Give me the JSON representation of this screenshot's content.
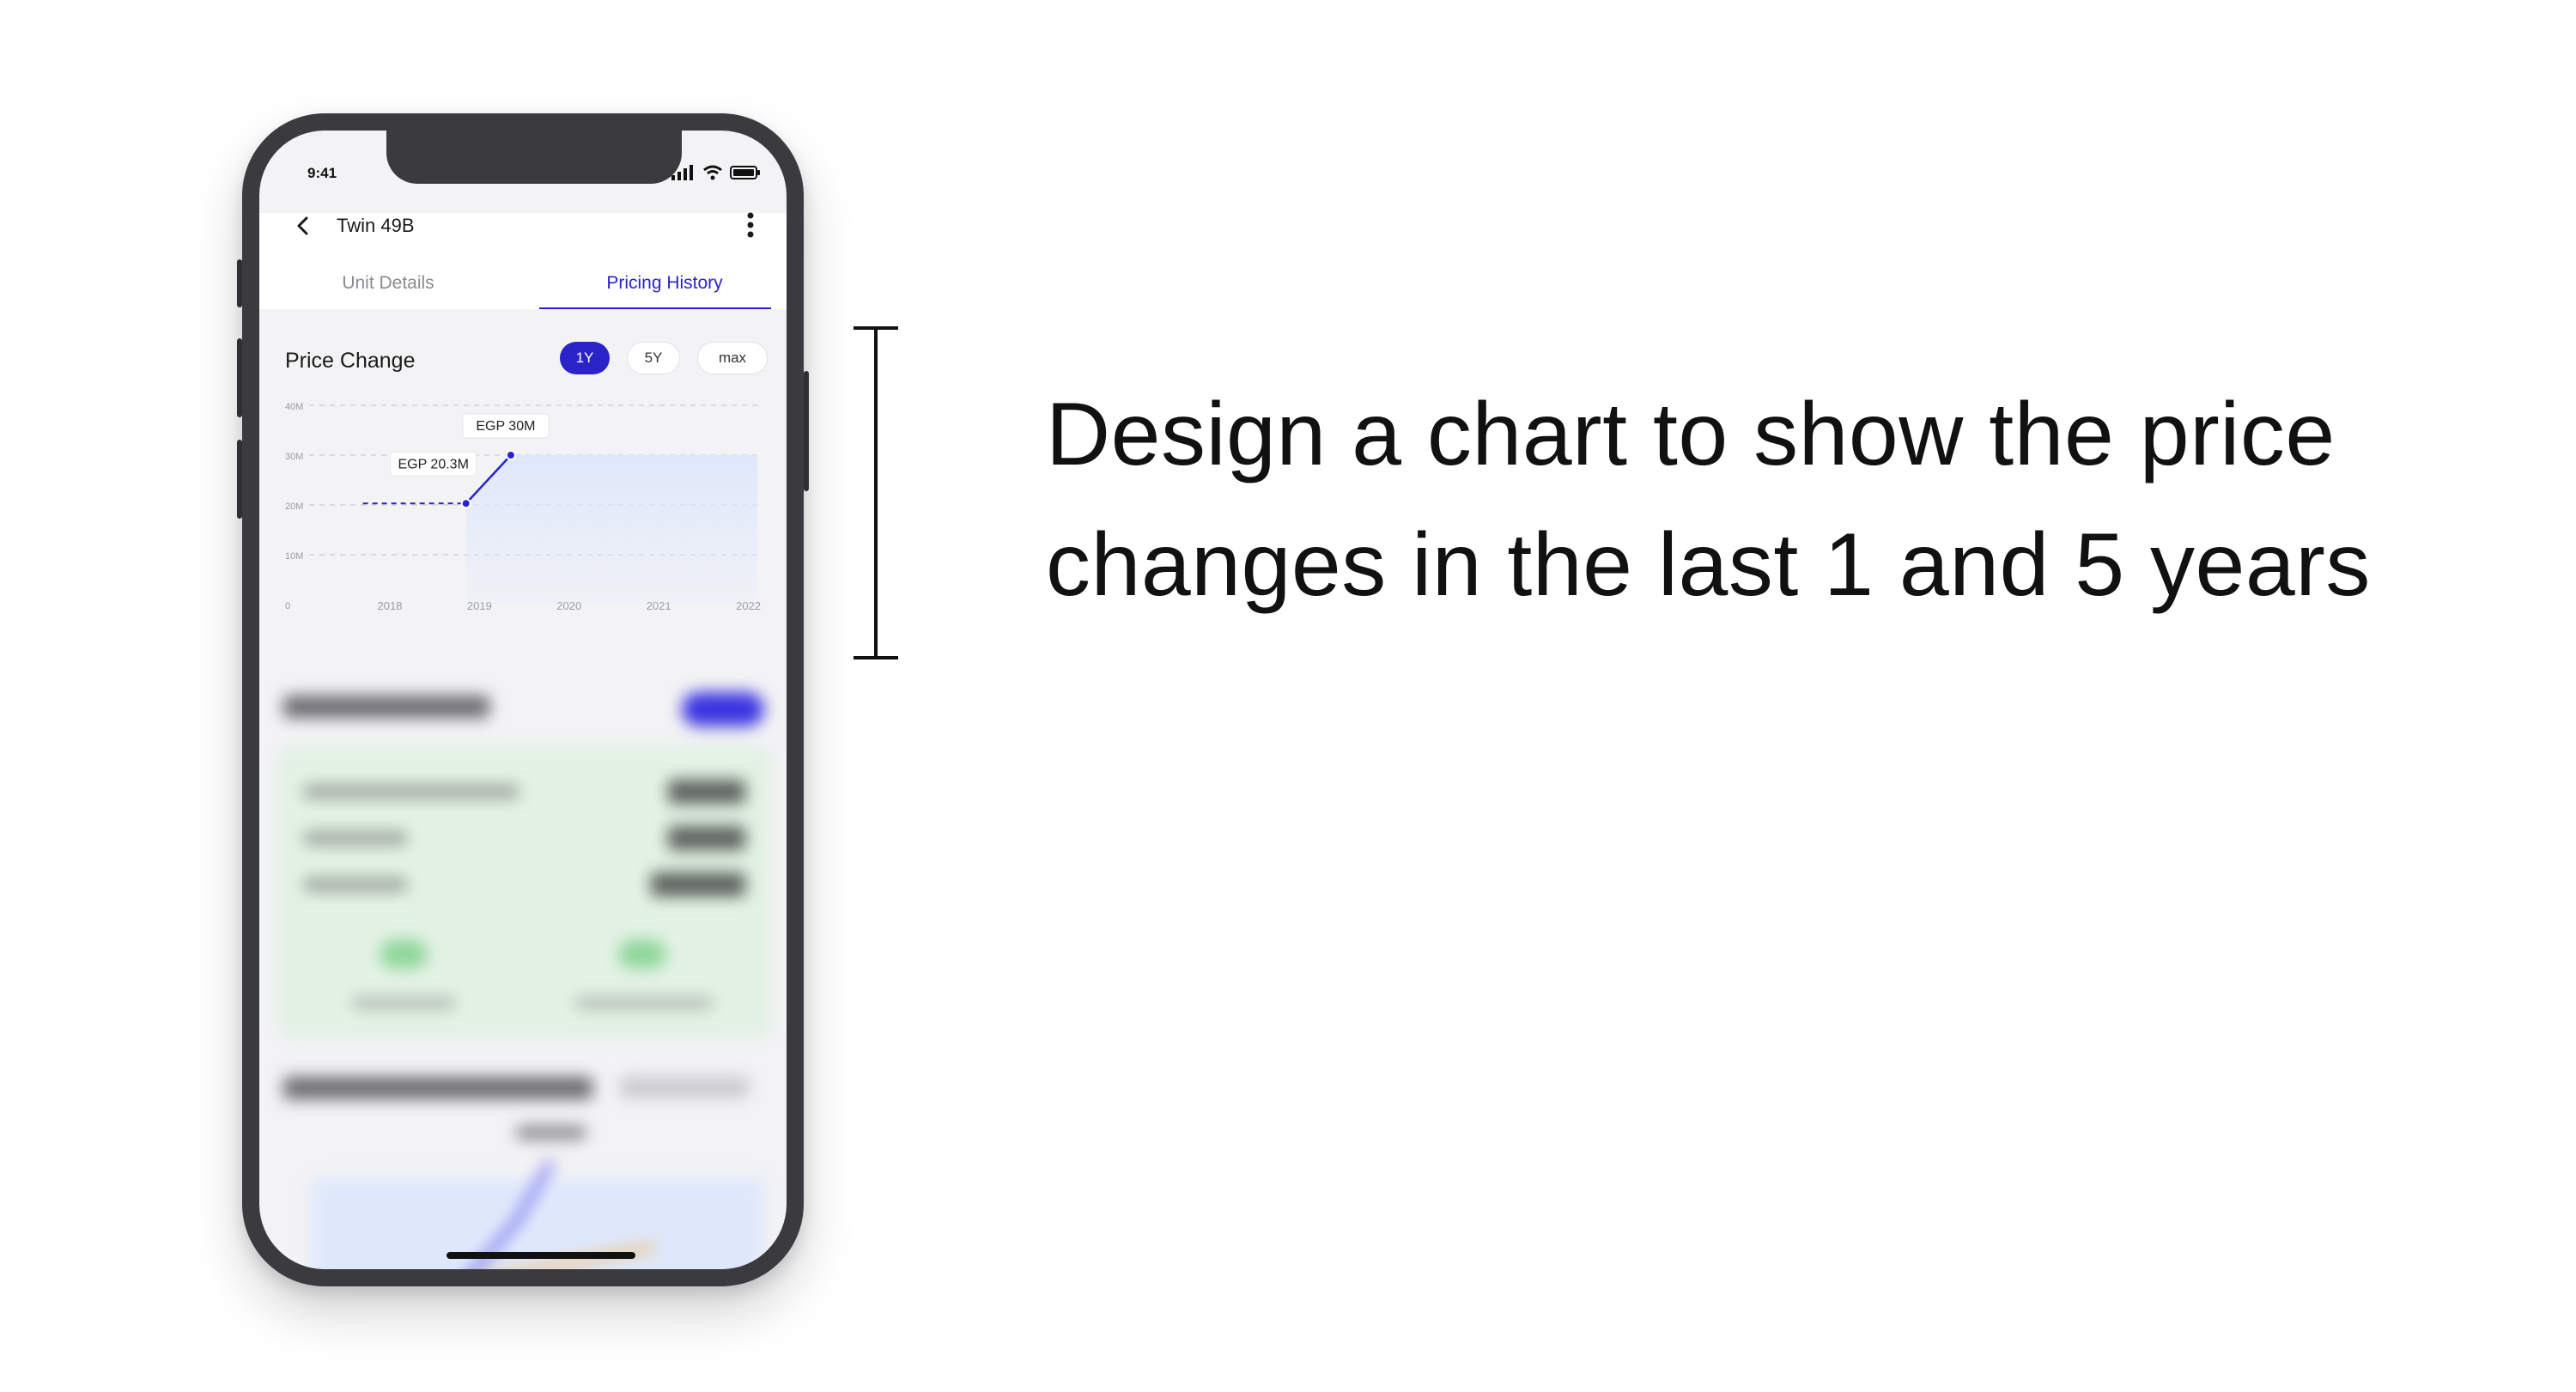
{
  "status_bar": {
    "time": "9:41"
  },
  "header": {
    "title": "Twin 49B"
  },
  "tabs": [
    {
      "label": "Unit Details",
      "active": false
    },
    {
      "label": "Pricing History",
      "active": true
    }
  ],
  "price_card": {
    "title": "Price Change",
    "ranges": [
      {
        "label": "1Y",
        "active": true
      },
      {
        "label": "5Y",
        "active": false
      },
      {
        "label": "max",
        "active": false
      }
    ]
  },
  "chart_data": {
    "type": "line",
    "title": "",
    "xlabel": "",
    "ylabel": "",
    "x_ticks": [
      "2018",
      "2019",
      "2020",
      "2021",
      "2022"
    ],
    "y_ticks": [
      "0",
      "10M",
      "20M",
      "30M",
      "40M"
    ],
    "ylim": [
      0,
      40
    ],
    "series": [
      {
        "points": [
          {
            "x": 2017.7,
            "y": 20.3
          },
          {
            "x": 2018.85,
            "y": 20.3
          },
          {
            "x": 2019.35,
            "y": 30
          }
        ]
      }
    ],
    "annotations": [
      {
        "label": "EGP 20.3M",
        "x": 2018.85,
        "y": 20.3
      },
      {
        "label": "EGP 30M",
        "x": 2019.35,
        "y": 30
      }
    ],
    "grid": true,
    "colors": {
      "line": "#2a24c8",
      "area": "#dfe8fb"
    }
  },
  "colors": {
    "accent": "#2a24c8",
    "frame": "#3a3a3f",
    "screen_bg": "#f3f3f5"
  },
  "headline": {
    "line1": "Design a chart to show the price",
    "line2": "changes in the last 1 and 5 years"
  }
}
